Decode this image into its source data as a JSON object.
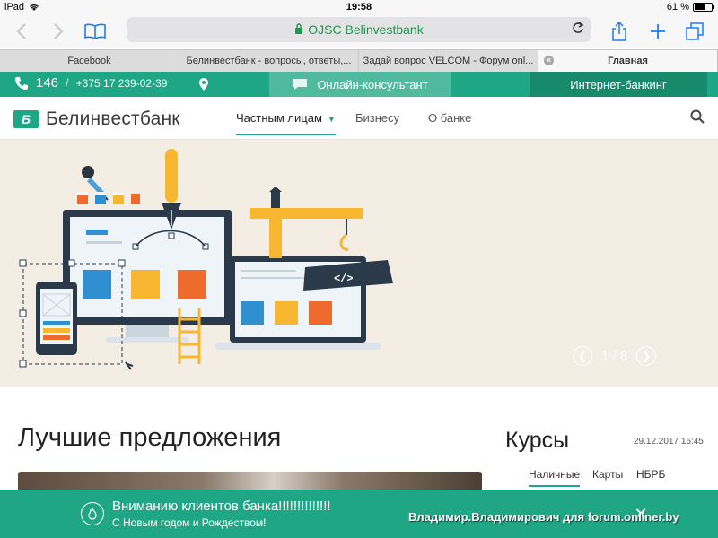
{
  "status_bar": {
    "device": "iPad",
    "time": "19:58",
    "battery_text": "61 %",
    "battery_level": 0.61
  },
  "browser": {
    "url": "OJSC Belinvestbank",
    "tabs": [
      {
        "label": "Facebook",
        "active": false
      },
      {
        "label": "Белинвестбанк - вопросы, ответы,...",
        "active": false
      },
      {
        "label": "Задай вопрос VELCOM - Форум onl...",
        "active": false
      },
      {
        "label": "Главная",
        "active": true
      }
    ]
  },
  "topbar": {
    "short_phone": "146",
    "separator": "/",
    "long_phone": "+375 17 239-02-39",
    "consultant": "Онлайн-консультант",
    "internet_banking": "Интернет-банкинг"
  },
  "header": {
    "logo": "Белинвестбанк",
    "nav": [
      {
        "label": "Частным лицам",
        "active": true
      },
      {
        "label": "Бизнесу",
        "active": false
      },
      {
        "label": "О банке",
        "active": false
      }
    ]
  },
  "hero": {
    "slide_counter": "1 / 8"
  },
  "best_offers": {
    "title": "Лучшие предложения"
  },
  "rates": {
    "title": "Курсы",
    "date": "29.12.2017 16:45",
    "tabs": [
      {
        "label": "Наличные",
        "active": true
      },
      {
        "label": "Карты",
        "active": false
      },
      {
        "label": "НБРБ",
        "active": false
      }
    ]
  },
  "notice": {
    "title": "Вниманию клиентов банка!!!!!!!!!!!!!!",
    "subtitle": "С Новым годом и Рождеством!"
  },
  "watermark": "Владимир.Владимирович для forum.onliner.by",
  "colors": {
    "brand": "#1fa685",
    "accent_dark": "#178a6d",
    "safari_blue": "#1e7cf2"
  }
}
